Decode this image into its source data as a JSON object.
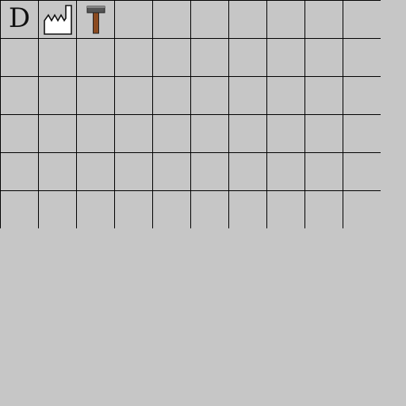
{
  "palette": {
    "tools": [
      {
        "id": "tool-d",
        "type": "text",
        "label": "D",
        "icon": "letter-d-icon"
      },
      {
        "id": "tool-factory",
        "type": "icon",
        "icon": "factory-icon"
      },
      {
        "id": "tool-hammer",
        "type": "icon",
        "icon": "hammer-icon"
      }
    ],
    "columns": 10,
    "rows": 6
  },
  "colors": {
    "background": "#c6c6c6",
    "grid_line": "#000000",
    "hammer_head": "#555555",
    "hammer_handle": "#8b4a1f"
  }
}
